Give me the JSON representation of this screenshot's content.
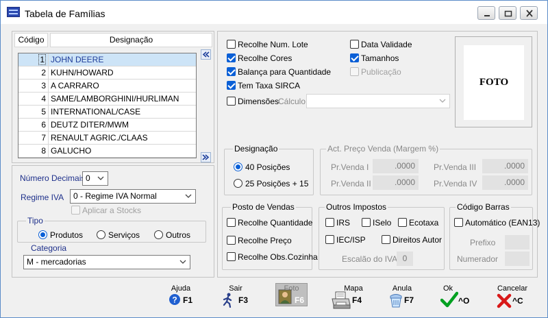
{
  "window": {
    "title": "Tabela de Famílias"
  },
  "grid": {
    "col_code": "Código",
    "col_name": "Designação",
    "rows": [
      {
        "num": "1",
        "name": "JOHN DEERE",
        "selected": true
      },
      {
        "num": "2",
        "name": "KUHN/HOWARD"
      },
      {
        "num": "3",
        "name": "A CARRARO"
      },
      {
        "num": "4",
        "name": "SAME/LAMBORGHINI/HURLIMAN"
      },
      {
        "num": "5",
        "name": "INTERNATIONAL/CASE"
      },
      {
        "num": "6",
        "name": "DEUTZ DITER/MWM"
      },
      {
        "num": "7",
        "name": "RENAULT AGRIC./CLAAS"
      },
      {
        "num": "8",
        "name": "GALUCHO"
      }
    ]
  },
  "left_form": {
    "decimals_label": "Número Decimais:",
    "decimals_value": "0",
    "regime_label": "Regime  IVA",
    "regime_value": "0 - Regime IVA Normal",
    "apply_stocks": "Aplicar a Stocks",
    "tipo_title": "Tipo",
    "tipo_options": [
      "Produtos",
      "Serviços",
      "Outros"
    ],
    "tipo_selected": 0,
    "categoria_label": "Categoria",
    "categoria_value": "M - mercadorias"
  },
  "options": {
    "recolhe_lote": "Recolhe Num. Lote",
    "recolhe_cores": "Recolhe Cores",
    "balanca": "Balança para Quantidade",
    "taxa_sirca": "Tem Taxa SIRCA",
    "dimensoes": "Dimensões",
    "calculo_label": "Cálculo:",
    "data_validade": "Data Validade",
    "tamanhos": "Tamanhos",
    "publicacao": "Publicação"
  },
  "foto": {
    "label": "FOTO"
  },
  "designacao": {
    "title": "Designação",
    "opt1": "40 Posições",
    "opt2": "25 Posições + 15"
  },
  "preco": {
    "title": "Act. Preço Venda (Margem %)",
    "fields": [
      {
        "label": "Pr.Venda I",
        "value": ".0000"
      },
      {
        "label": "Pr.Venda II",
        "value": ".0000"
      },
      {
        "label": "Pr.Venda III",
        "value": ".0000"
      },
      {
        "label": "Pr.Venda IV",
        "value": ".0000"
      }
    ]
  },
  "posto": {
    "title": "Posto de Vendas",
    "quantidade": "Recolhe Quantidade",
    "preco": "Recolhe Preço",
    "obs": "Recolhe Obs.Cozinha"
  },
  "impostos": {
    "title": "Outros Impostos",
    "irs": "IRS",
    "iselo": "ISelo",
    "ecotaxa": "Ecotaxa",
    "iec": "IEC/ISP",
    "direitos": "Direitos Autor",
    "escalao_label": "Escalão do IVA",
    "escalao_value": "0"
  },
  "barras": {
    "title": "Código Barras",
    "automatico": "Automático (EAN13)",
    "prefixo": "Prefixo",
    "numerador": "Numerador"
  },
  "toolbar": [
    {
      "top": "Ajuda",
      "key": "F1",
      "icon": "help-icon"
    },
    {
      "top": "Sair",
      "key": "F3",
      "icon": "exit-runner-icon"
    },
    {
      "top": "Foto",
      "key": "F6",
      "icon": "photo-portrait-icon"
    },
    {
      "top": "Mapa",
      "key": "F4",
      "icon": "printer-icon"
    },
    {
      "top": "Anula",
      "key": "F7",
      "icon": "cancel-eraser-icon"
    },
    {
      "top": "Ok",
      "key": "^O",
      "icon": "check-icon"
    },
    {
      "top": "Cancelar",
      "key": "^C",
      "icon": "close-x-icon"
    }
  ],
  "colors": {
    "accent": "#0a5fd6",
    "selection": "#cde4f7",
    "check": "#00a020",
    "cross": "#d81818"
  }
}
